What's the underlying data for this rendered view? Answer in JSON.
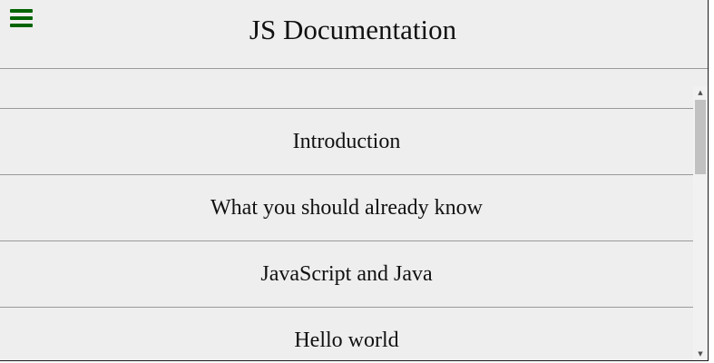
{
  "header": {
    "title": "JS Documentation",
    "menu_icon": "hamburger-menu-icon",
    "accent_color": "#006400"
  },
  "nav": {
    "items": [
      {
        "label": "Introduction"
      },
      {
        "label": "What you should already know"
      },
      {
        "label": "JavaScript and Java"
      },
      {
        "label": "Hello world"
      }
    ]
  },
  "scrollbar": {
    "up_arrow": "▲",
    "down_arrow": "▼"
  }
}
